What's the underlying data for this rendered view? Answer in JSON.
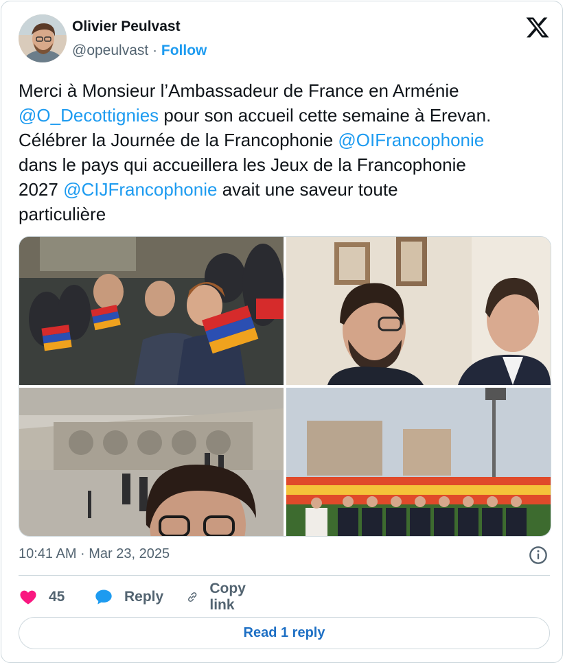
{
  "author": {
    "name": "Olivier Peulvast",
    "handle": "@opeulvast",
    "separator": "·",
    "follow_label": "Follow"
  },
  "tweet": {
    "segments": [
      {
        "text": "Merci à Monsieur l’Ambassadeur de France en Arménie\n",
        "mention": false
      },
      {
        "text": "@O_Decottignies",
        "mention": true
      },
      {
        "text": " pour son accueil cette semaine à Erevan.\nCélébrer la Journée de la Francophonie ",
        "mention": false
      },
      {
        "text": "@OIFrancophonie",
        "mention": true
      },
      {
        "text": "\ndans le pays qui accueillera les Jeux de la Francophonie\n2027 ",
        "mention": false
      },
      {
        "text": "@CIJFrancophonie",
        "mention": true
      },
      {
        "text": " avait une saveur toute\nparticulière",
        "mention": false
      }
    ]
  },
  "media": {
    "photos": [
      {
        "name": "photo-stadium-crowd-flags"
      },
      {
        "name": "photo-men-at-meeting"
      },
      {
        "name": "photo-cascade-selfie"
      },
      {
        "name": "photo-stadium-group"
      }
    ]
  },
  "meta": {
    "timestamp": "10:41 AM · Mar 23, 2025"
  },
  "actions": {
    "like_count": "45",
    "reply_label": "Reply",
    "copy_label": "Copy link",
    "read_replies_label": "Read 1 reply"
  },
  "colors": {
    "accent": "#1d9bf0",
    "like": "#f91880",
    "muted": "#536471",
    "border": "#cfd9de"
  },
  "icons": [
    "x-logo-icon",
    "info-icon",
    "heart-icon",
    "reply-bubble-icon",
    "link-icon"
  ]
}
